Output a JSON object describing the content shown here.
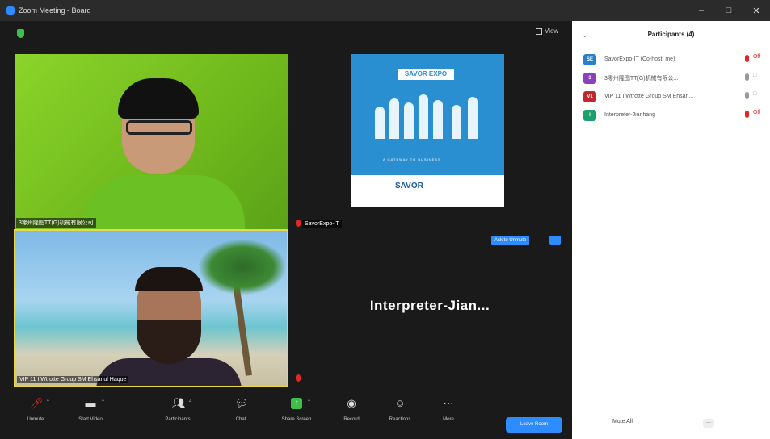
{
  "window": {
    "title": "Zoom Meeting - Board"
  },
  "meeting": {
    "view_label": "View",
    "tiles": [
      {
        "name": "3零州隆图TT(G)机械有限公司"
      },
      {
        "name": "SavorExpo-IT"
      },
      {
        "name": "VIP 11 I Wtrotte Group SM Ehsanul Haque"
      },
      {
        "name": "Interpreter-Jian..."
      }
    ],
    "ask_to_unmute": "Ask to Unmute",
    "more_dots": "..."
  },
  "poster": {
    "brand": "SAVOR EXPO",
    "tagline": "A GATEWAY TO BUSINESS",
    "logo": "SAVOR"
  },
  "toolbar": {
    "items": [
      {
        "label": "Unmute",
        "icon": "mic-muted-icon"
      },
      {
        "label": "Start Video",
        "icon": "video-off-icon"
      },
      {
        "label": "Participants",
        "icon": "participants-icon",
        "count": "4"
      },
      {
        "label": "Chat",
        "icon": "chat-icon"
      },
      {
        "label": "Share Screen",
        "icon": "share-screen-icon"
      },
      {
        "label": "Record",
        "icon": "record-icon"
      },
      {
        "label": "Reactions",
        "icon": "reactions-icon"
      },
      {
        "label": "More",
        "icon": "more-icon"
      }
    ],
    "leave_label": "Leave Room"
  },
  "panel": {
    "title": "Participants (4)",
    "participants": [
      {
        "avatar_text": "SE",
        "avatar_color": "#2a7fc9",
        "name": "SavorExpo-IT (Co-host, me)",
        "mic_color": "#e02828",
        "video": "Off"
      },
      {
        "avatar_text": "3",
        "avatar_color": "#8a3fbf",
        "name": "3零州隆图TT(G)机械有限公...",
        "mic_color": "#999999",
        "video": "□"
      },
      {
        "avatar_text": "V1",
        "avatar_color": "#c0282d",
        "name": "VIP 11 I Wtrotte Group SM Ehsan...",
        "mic_color": "#999999",
        "video": "□"
      },
      {
        "avatar_text": "I",
        "avatar_color": "#1f9e6e",
        "name": "Interpreter-Jianhang",
        "mic_color": "#e02828",
        "video": "Off"
      }
    ],
    "mute_all": "Mute All",
    "more_label": "..."
  },
  "colors": {
    "accent": "#2d8cff",
    "muted_red": "#e02828",
    "active_speaker_border": "#e8d84a"
  }
}
